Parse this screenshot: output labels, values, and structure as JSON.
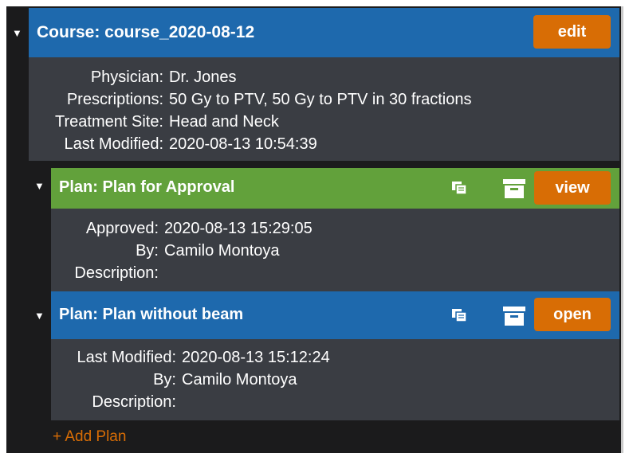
{
  "course": {
    "title": "Course: course_2020-08-12",
    "edit_label": "edit",
    "fields": [
      {
        "label": "Physician:",
        "value": "Dr. Jones"
      },
      {
        "label": "Prescriptions:",
        "value": "50 Gy to PTV, 50 Gy to PTV in 30 fractions"
      },
      {
        "label": "Treatment Site:",
        "value": "Head and Neck"
      },
      {
        "label": "Last Modified:",
        "value": "2020-08-13 10:54:39"
      }
    ]
  },
  "plans": [
    {
      "title": "Plan: Plan for Approval",
      "button_label": "view",
      "header_color": "#62a13b",
      "fields": [
        {
          "label": "Approved:",
          "value": "2020-08-13 15:29:05"
        },
        {
          "label": "By:",
          "value": "Camilo Montoya"
        },
        {
          "label": "Description:",
          "value": ""
        }
      ]
    },
    {
      "title": "Plan: Plan without beam",
      "button_label": "open",
      "header_color": "#1e69ad",
      "fields": [
        {
          "label": "Last Modified:",
          "value": "2020-08-13 15:12:24"
        },
        {
          "label": "By:",
          "value": "Camilo Montoya"
        },
        {
          "label": "Description:",
          "value": ""
        }
      ]
    }
  ],
  "add_plan_label": "+ Add Plan",
  "icons": {
    "expand": "caret-down-icon",
    "copy": "copy-icon",
    "archive": "archive-icon"
  },
  "colors": {
    "accent_button": "#d86d05",
    "course_header": "#1e69ad",
    "approved_header": "#62a13b",
    "body_bg": "#3a3d43"
  }
}
